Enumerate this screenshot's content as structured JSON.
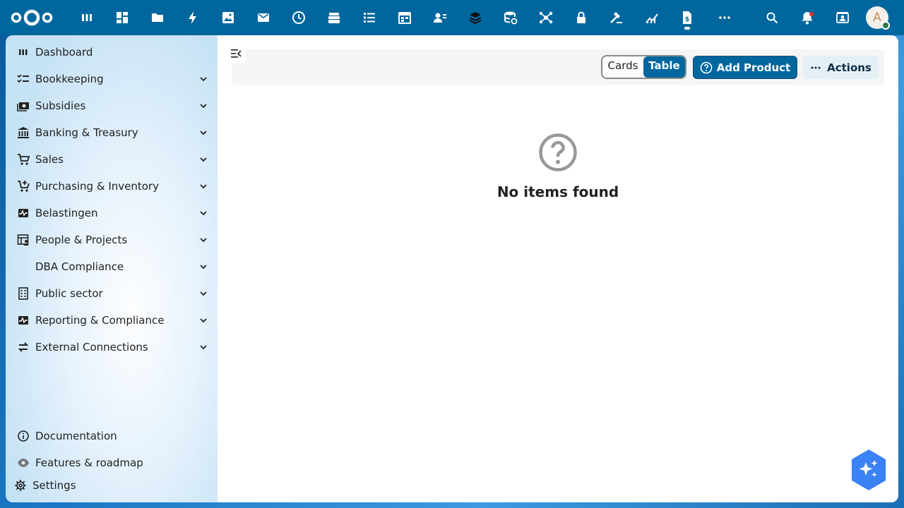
{
  "header": {
    "apps": [
      {
        "name": "dashboard-app-icon"
      },
      {
        "name": "apps-grid-icon"
      },
      {
        "name": "files-icon"
      },
      {
        "name": "activity-icon"
      },
      {
        "name": "photos-icon"
      },
      {
        "name": "mail-icon"
      },
      {
        "name": "clock-icon"
      },
      {
        "name": "deck-icon"
      },
      {
        "name": "tasks-icon"
      },
      {
        "name": "calendar-icon"
      },
      {
        "name": "contacts-icon"
      },
      {
        "name": "layers-icon"
      },
      {
        "name": "database-icon"
      },
      {
        "name": "network-icon"
      },
      {
        "name": "lock-icon"
      },
      {
        "name": "gavel-icon"
      },
      {
        "name": "chart-icon"
      },
      {
        "name": "finance-document-icon"
      },
      {
        "name": "more-apps-icon"
      }
    ],
    "avatar_initial": "A"
  },
  "sidebar": {
    "items": [
      {
        "label": "Dashboard",
        "icon": "dashboard-icon",
        "expandable": false
      },
      {
        "label": "Bookkeeping",
        "icon": "checklist-icon",
        "expandable": true
      },
      {
        "label": "Subsidies",
        "icon": "cash-icon",
        "expandable": true
      },
      {
        "label": "Banking & Treasury",
        "icon": "bank-icon",
        "expandable": true
      },
      {
        "label": "Sales",
        "icon": "cart-icon",
        "expandable": true
      },
      {
        "label": "Purchasing & Inventory",
        "icon": "cart-plus-icon",
        "expandable": true
      },
      {
        "label": "Belastingen",
        "icon": "pulse-icon",
        "expandable": true
      },
      {
        "label": "People & Projects",
        "icon": "people-table-icon",
        "expandable": true
      },
      {
        "label": "DBA Compliance",
        "icon": "",
        "expandable": true
      },
      {
        "label": "Public sector",
        "icon": "building-icon",
        "expandable": true
      },
      {
        "label": "Reporting & Compliance",
        "icon": "pulse-icon",
        "expandable": true
      },
      {
        "label": "External Connections",
        "icon": "swap-icon",
        "expandable": true
      }
    ],
    "footer": {
      "documentation": "Documentation",
      "features": "Features & roadmap",
      "settings": "Settings"
    }
  },
  "toolbar": {
    "view_cards": "Cards",
    "view_table": "Table",
    "selected_view": "Table",
    "add_label": "Add Product",
    "actions_label": "Actions"
  },
  "main": {
    "empty_title": "No items found"
  },
  "colors": {
    "primary": "#00679e",
    "header_bg": "#00679e",
    "assistant": "#3b82f6"
  }
}
